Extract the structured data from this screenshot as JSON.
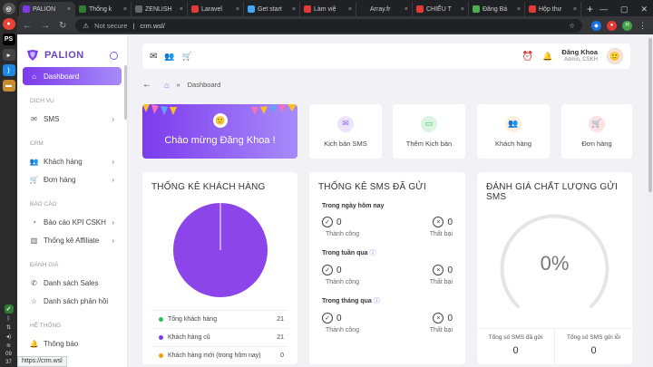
{
  "browser": {
    "tabs": [
      {
        "label": "PALION",
        "color": "#7c3aed"
      },
      {
        "label": "Thống k",
        "color": "#2e7d32"
      },
      {
        "label": "ZENLISH",
        "color": "#666666"
      },
      {
        "label": "Laravel",
        "color": "#e53935"
      },
      {
        "label": "Get start",
        "color": "#42a5f5"
      },
      {
        "label": "Làm việ",
        "color": "#e53935"
      },
      {
        "label": "Array.fr",
        "color": "#222222"
      },
      {
        "label": "CHIẾU T",
        "color": "#e53935"
      },
      {
        "label": "Đăng Bà",
        "color": "#4caf50"
      },
      {
        "label": "Hộp thư",
        "color": "#e53935"
      }
    ],
    "security": "Not secure",
    "url": "crm.wsl/",
    "status_url": "https://crm.wsl"
  },
  "os": {
    "time_h": "09",
    "time_m": "37"
  },
  "sidebar": {
    "brand": "PALION",
    "active": "Dashboard",
    "sections": {
      "dichvu": "DỊCH VỤ",
      "crm": "CRM",
      "baocao": "BÁO CÁO",
      "danhgia": "ĐÁNH GIÁ",
      "hethong": "HỆ THỐNG"
    },
    "items": {
      "sms": "SMS",
      "khachhang": "Khách hàng",
      "donhang": "Đơn hàng",
      "kpi": "Báo cáo KPI CSKH",
      "affiliate": "Thống kê Affiliate",
      "sales": "Danh sách Sales",
      "phanhoi": "Danh sách phản hồi",
      "thongbao": "Thông báo"
    }
  },
  "header": {
    "user_name": "Đăng Khoa",
    "user_role": "Admin, CSKH"
  },
  "breadcrumb": {
    "current": "Dashboard"
  },
  "welcome": {
    "text": "Chào mừng Đăng Khoa !"
  },
  "quick": {
    "kichban_sms": "Kịch bản SMS",
    "them_kichban": "Thêm Kịch bản",
    "khachhang": "Khách hàng",
    "donhang": "Đơn hàng"
  },
  "customers": {
    "title": "THỐNG KÊ KHÁCH HÀNG",
    "legend": [
      {
        "label": "Tổng khách hàng",
        "value": "21",
        "color": "#22c55e"
      },
      {
        "label": "Khách hàng cũ",
        "value": "21",
        "color": "#7c3aed"
      },
      {
        "label": "Khách hàng mới (trong hôm nay)",
        "value": "0",
        "color": "#f59e0b"
      }
    ]
  },
  "chart_data": {
    "type": "pie",
    "categories": [
      "Khách hàng cũ",
      "Khách hàng mới (trong hôm nay)"
    ],
    "values": [
      21,
      0
    ],
    "colors": [
      "#8b45e8",
      "#f59e0b"
    ]
  },
  "sms": {
    "title": "THỐNG KÊ SMS ĐÃ GỬI",
    "success_label": "Thành công",
    "fail_label": "Thất bại",
    "periods": [
      {
        "label": "Trong ngày hôm nay",
        "success": "0",
        "fail": "0"
      },
      {
        "label": "Trong tuần qua",
        "success": "0",
        "fail": "0"
      },
      {
        "label": "Trong tháng qua",
        "success": "0",
        "fail": "0"
      }
    ]
  },
  "quality": {
    "title": "ĐÁNH GIÁ CHẤT LƯỢNG GỬI SMS",
    "percent": "0%",
    "sent_label": "Tổng số SMS đã gửi",
    "sent_value": "0",
    "error_label": "Tổng số SMS gửi lỗi",
    "error_value": "0"
  }
}
